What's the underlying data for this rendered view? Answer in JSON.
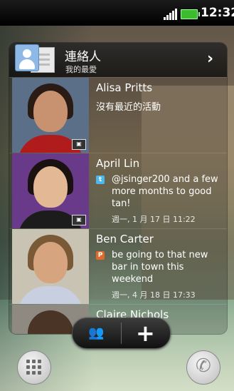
{
  "status_bar": {
    "time": "12:32"
  },
  "widget": {
    "title": "連絡人",
    "subtitle": "我的最愛",
    "contacts": [
      {
        "name": "Alisa Pritts",
        "status": "沒有最近的活動",
        "time": "",
        "source": ""
      },
      {
        "name": "April Lin",
        "status": "@jsinger200 and a few more months to good tan!",
        "time": "週一, 1 月 17 日 11:22",
        "source": "twitter"
      },
      {
        "name": "Ben Carter",
        "status": "be going to that new bar in town this weekend",
        "time": "週一, 4 月 18 日 17:33",
        "source": "P"
      },
      {
        "name": "Claire Nichols"
      }
    ]
  },
  "colors": {
    "twitter": "#4cb9e8",
    "source_p": "#e06a2b"
  },
  "dock": {
    "apps_icon": "apps-grid-icon",
    "phone_icon": "phone-icon"
  }
}
